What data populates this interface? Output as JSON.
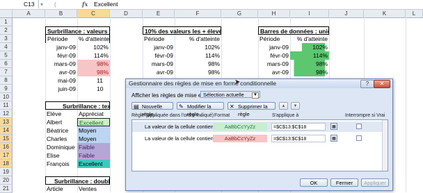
{
  "formula_bar": {
    "name_box": "C13",
    "fx_symbol": "fx",
    "value": "Excellent",
    "btn_cancel": "▾",
    "btn_enter": "(",
    "btn_insert": ""
  },
  "columns": [
    "A",
    "B",
    "C",
    "D",
    "E",
    "F",
    "G",
    "H",
    "I",
    "J",
    "K",
    "L"
  ],
  "rows": [
    "1",
    "2",
    "3",
    "4",
    "5",
    "6",
    "7",
    "8",
    "9",
    "10",
    "11",
    "12",
    "13",
    "14",
    "15",
    "16",
    "17",
    "18",
    "19",
    "20",
    "21"
  ],
  "sheet": {
    "t1": {
      "title": "Surbrillance : valeurs",
      "h1": "Période",
      "h2": "% d'atteinte",
      "rows": [
        [
          "janv-09",
          "102%"
        ],
        [
          "févr-09",
          "114%"
        ],
        [
          "mars-09",
          "98%"
        ],
        [
          "avr-09",
          "98%"
        ],
        [
          "mai-09",
          "11"
        ],
        [
          "juin-09",
          "10"
        ]
      ]
    },
    "t2": {
      "title": "10% des valeurs les + élevées",
      "h1": "Période",
      "h2": "% d'atteinte",
      "rows": [
        [
          "janv-09",
          "102%"
        ],
        [
          "févr-09",
          "114%"
        ],
        [
          "mars-09",
          "98%"
        ],
        [
          "avr-09",
          "98%"
        ]
      ]
    },
    "t3": {
      "title": "Barres de données : unies",
      "h1": "Période",
      "h2": "% d'atteinte",
      "rows": [
        [
          "janv-09",
          "102%"
        ],
        [
          "févr-09",
          "114%"
        ],
        [
          "mars-09",
          "98%"
        ],
        [
          "avr-09",
          "98%"
        ]
      ]
    },
    "t4": {
      "title": "Surbrillance : texte",
      "h1": "Elève",
      "h2": "Appréciat",
      "rows": [
        [
          "Albert",
          "Excellent"
        ],
        [
          "Béatrice",
          "Moyen"
        ],
        [
          "Charles",
          "Moyen"
        ],
        [
          "Dominique",
          "Faible"
        ],
        [
          "Elise",
          "Faible"
        ],
        [
          "François",
          "Excellent"
        ]
      ]
    },
    "t5": {
      "title": "Surbrillance : doublor",
      "h1": "Article",
      "h2": "Ventes"
    }
  },
  "dialog": {
    "title": "Gestionnaire des règles de mise en forme conditionnelle",
    "help": "?",
    "close": "✕",
    "show_label": "Afficher les règles de mise en forme pour :",
    "show_value": "Sélection actuelle",
    "new_rule": "Nouvelle règle...",
    "edit_rule": "Modifier la règle...",
    "delete_rule": "Supprimer la règle",
    "col_rule": "Règle (appliquée dans l'ordre indiqué)",
    "col_format": "Format",
    "col_applies": "S'applique à",
    "col_stop": "Interrompre si Vrai",
    "rules": [
      {
        "desc": "La valeur de la cellule contient ...",
        "format": "AaBbCcYyZz",
        "applies": "=$C$13:$C$18"
      },
      {
        "desc": "La valeur de la cellule contient ...",
        "format": "AaBbCcYyZz",
        "applies": "=$C$13:$C$18"
      }
    ],
    "ok": "OK",
    "close_btn": "Fermer",
    "apply": "Appliquer"
  }
}
